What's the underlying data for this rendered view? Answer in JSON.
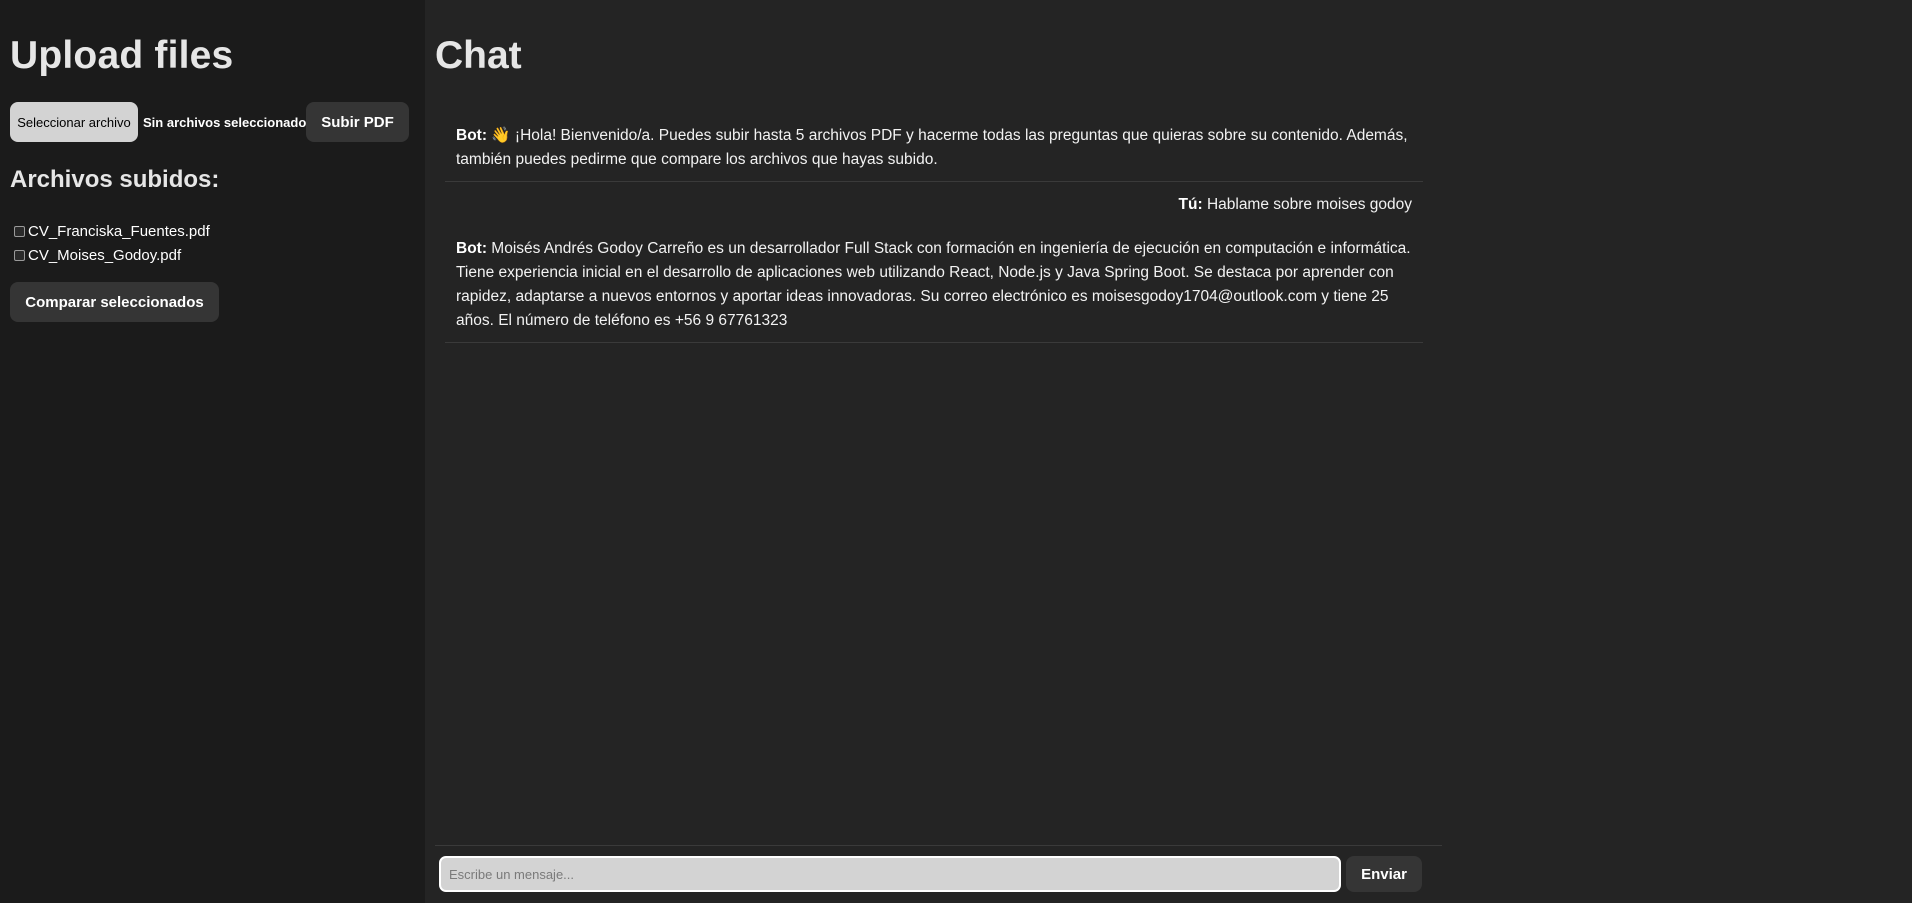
{
  "sidebar": {
    "title": "Upload files",
    "file_button_label": "Seleccionar archivo",
    "file_status": "Sin archivos seleccionados",
    "upload_button_label": "Subir PDF",
    "uploaded_title": "Archivos subidos:",
    "files": [
      {
        "name": "CV_Franciska_Fuentes.pdf",
        "checked": false
      },
      {
        "name": "CV_Moises_Godoy.pdf",
        "checked": false
      }
    ],
    "compare_button_label": "Comparar seleccionados"
  },
  "chat": {
    "title": "Chat",
    "messages": [
      {
        "sender": "Bot:",
        "role": "bot",
        "text": "👋 ¡Hola! Bienvenido/a. Puedes subir hasta 5 archivos PDF y hacerme todas las preguntas que quieras sobre su contenido. Además, también puedes pedirme que compare los archivos que hayas subido."
      },
      {
        "sender": "Tú:",
        "role": "user",
        "text": "Hablame sobre moises godoy"
      },
      {
        "sender": "Bot:",
        "role": "bot",
        "text": "Moisés Andrés Godoy Carreño es un desarrollador Full Stack con formación en ingeniería de ejecución en computación e informática. Tiene experiencia inicial en el desarrollo de aplicaciones web utilizando React, Node.js y Java Spring Boot. Se destaca por aprender con rapidez, adaptarse a nuevos entornos y aportar ideas innovadoras. Su correo electrónico es moisesgodoy1704@outlook.com y tiene 25 años. El número de teléfono es +56 9 67761323"
      }
    ],
    "input_placeholder": "Escribe un mensaje...",
    "send_button_label": "Enviar"
  }
}
